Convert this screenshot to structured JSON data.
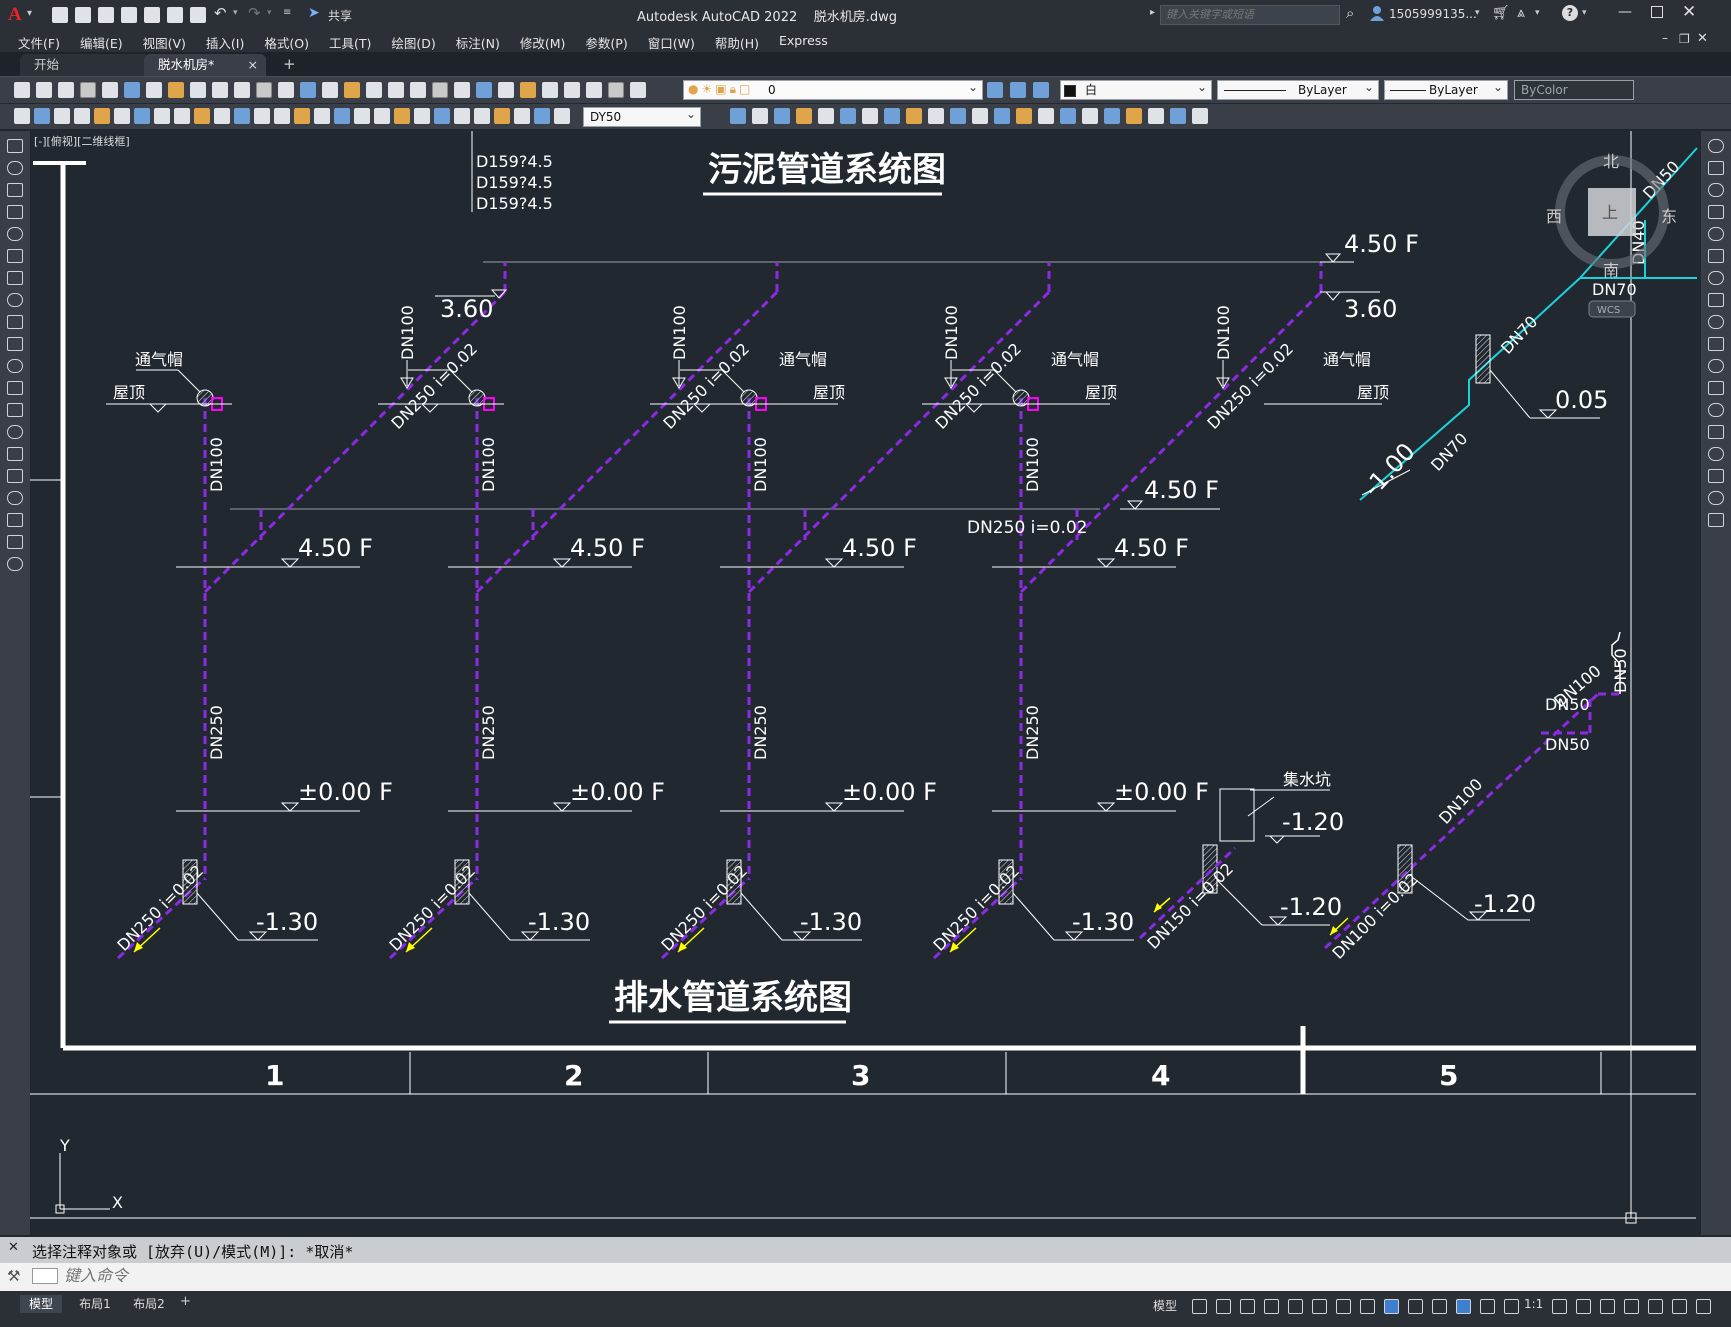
{
  "window": {
    "title": "Autodesk AutoCAD 2022    脱水机房.dwg",
    "share_label": "共享",
    "search_placeholder": "键入关键字或短语",
    "user_name": "1505999135...",
    "app_letter": "A"
  },
  "menu": [
    "文件(F)",
    "编辑(E)",
    "视图(V)",
    "插入(I)",
    "格式(O)",
    "工具(T)",
    "绘图(D)",
    "标注(N)",
    "修改(M)",
    "参数(P)",
    "窗口(W)",
    "帮助(H)",
    "Express"
  ],
  "doc_tabs": [
    {
      "label": "开始",
      "active": false
    },
    {
      "label": "脱水机房*",
      "active": true,
      "close": "×"
    }
  ],
  "new_tab_label": "+",
  "toolbar": {
    "layer_value": "0",
    "color_value": "白",
    "linetype_value": "ByLayer",
    "lineweight_value": "ByLayer",
    "plotstyle_value": "ByColor",
    "dimstyle_value": "DY50"
  },
  "viewport_label": "[-][俯视][二维线框]",
  "viewcube": {
    "north": "北",
    "south": "南",
    "east": "东",
    "west": "西",
    "face": "上",
    "wcs": "WCS"
  },
  "ucs": {
    "x": "X",
    "y": "Y"
  },
  "drawing": {
    "title_sludge": "污泥管道系统图",
    "title_drain": "排水管道系统图",
    "d_list": [
      "D159?4.5",
      "D159?4.5",
      "D159?4.5"
    ],
    "vent_cap": "通气帽",
    "roof": "屋顶",
    "elev_top_right": "4.50 F",
    "elev_360": "3.60",
    "elev_450": "4.50 F",
    "elev_000": "±0.00 F",
    "elev_n130": "-1.30",
    "elev_n120": "-1.20",
    "elev_005": "0.05",
    "elev_n100": "-1.00",
    "pipe_dn100": "DN100",
    "pipe_dn250": "DN250",
    "pipe_dn250_slope": "DN250  i=0.02",
    "pipe_dn250_slope_low": "DN250  i=0.02",
    "pipe_dn150_slope": "DN150 i=0.02",
    "pipe_dn100_slope": "DN100 i=0.02",
    "pipe_dn70": "DN70",
    "pipe_dn50": "DN50",
    "pipe_dn40": "DN40",
    "sump": "集水坑",
    "columns": [
      "1",
      "2",
      "3",
      "4",
      "5"
    ]
  },
  "command": {
    "history": "选择注释对象或 [放弃(U)/模式(M)]: *取消*",
    "placeholder": "键入命令"
  },
  "layout_tabs": [
    "模型",
    "布局1",
    "布局2"
  ],
  "status": {
    "model_label": "模型",
    "scale": "1:1"
  },
  "colors": {
    "pipe": "#8a2be2",
    "cyan": "#19d3dc",
    "bg": "#212830",
    "magenta": "#ff00ff",
    "yellow": "#ffff00"
  }
}
